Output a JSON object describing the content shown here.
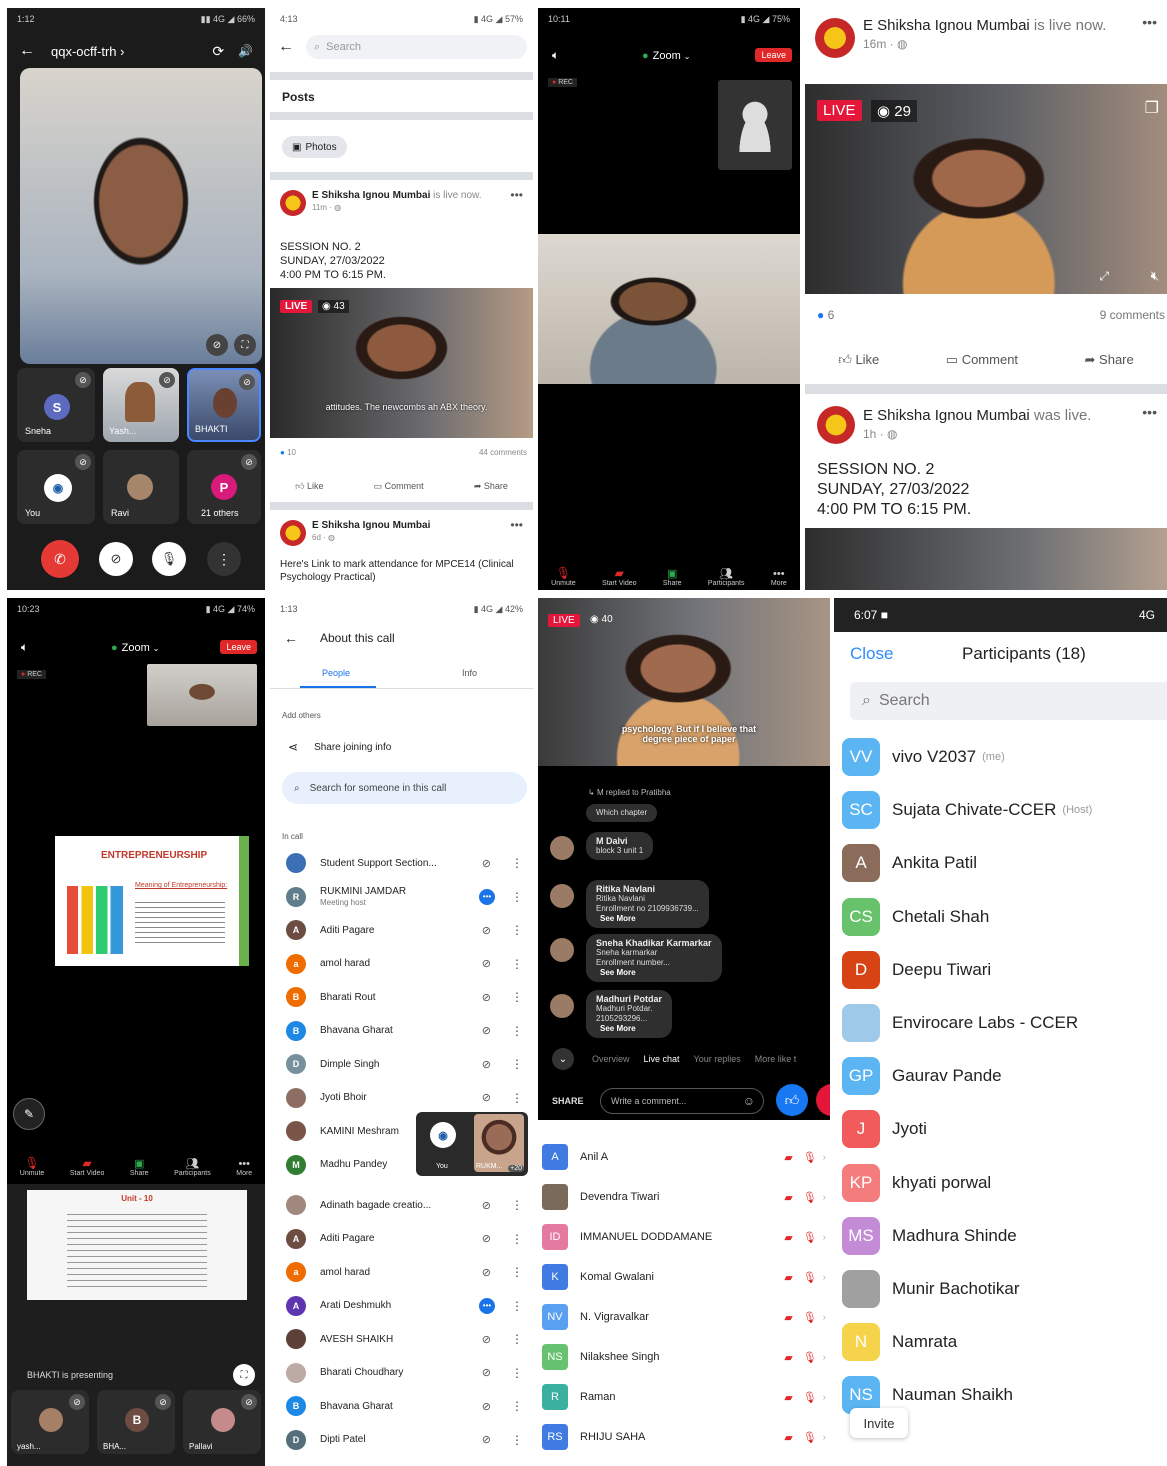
{
  "p1": {
    "status_time": "1:12",
    "meeting_code": "qqx-ocff-trh ›",
    "tiles": [
      {
        "name": "Sneha",
        "initial": "S"
      },
      {
        "name": "Yash...",
        "initial": ""
      },
      {
        "name": "BHAKTI",
        "initial": ""
      },
      {
        "name": "You",
        "initial": ""
      },
      {
        "name": "Ravi",
        "initial": ""
      },
      {
        "name": "21 others",
        "initial": "P"
      }
    ]
  },
  "p2": {
    "status_time": "4:13",
    "search_placeholder": "Search",
    "posts_label": "Posts",
    "photos_chip": "Photos",
    "post1": {
      "page": "E Shiksha Ignou Mumbai",
      "suffix": " is live now.",
      "time": "11m · ",
      "line1": "SESSION NO. 2",
      "line2": "SUNDAY, 27/03/2022",
      "line3": "4:00 PM TO 6:15 PM.",
      "live": "LIVE",
      "viewers": "43",
      "caption": "attitudes. The newcombs ah ABX theory.",
      "likes": "10",
      "comments": "44 comments",
      "like": "Like",
      "comment": "Comment",
      "share": "Share"
    },
    "post2": {
      "page": "E Shiksha Ignou Mumbai",
      "time": "6d · ",
      "text": "Here's Link to mark attendance for MPCE14 (Clinical Psychology Practical)"
    }
  },
  "p3": {
    "status_time": "10:11",
    "zoom_label": "Zoom",
    "leave": "Leave",
    "rec": "REC",
    "bar": [
      "Unmute",
      "Start Video",
      "Share",
      "Participants",
      "More"
    ]
  },
  "p4": {
    "page": "E Shiksha Ignou Mumbai",
    "suffix": " is live now.",
    "time": "16m · ",
    "live": "LIVE",
    "viewers": "29",
    "likes": "6",
    "comments": "9 comments",
    "like": "Like",
    "comment": "Comment",
    "share": "Share",
    "post2_suffix": " was live.",
    "post2_time": "1h · ",
    "line1": "SESSION NO. 2",
    "line2": "SUNDAY, 27/03/2022",
    "line3": "4:00 PM TO 6:15 PM."
  },
  "p5": {
    "status_time": "10:23",
    "zoom_label": "Zoom",
    "leave": "Leave",
    "rec": "REC",
    "slide_title": "ENTREPRENEURSHIP",
    "slide_sub": "Meaning of Entrepreneurship:",
    "bar": [
      "Unmute",
      "Start Video",
      "Share",
      "Participants",
      "More"
    ],
    "unit_title": "Unit - 10",
    "presenting": "BHAKTI is presenting",
    "bottom_tiles": [
      {
        "name": "yash...",
        "initial": ""
      },
      {
        "name": "BHA...",
        "initial": "B"
      },
      {
        "name": "Pallavi",
        "initial": ""
      }
    ]
  },
  "p6": {
    "status_time": "1:13",
    "title": "About this call",
    "tab_people": "People",
    "tab_info": "Info",
    "add_others": "Add others",
    "share_info": "Share joining info",
    "search_placeholder": "Search for someone in this call",
    "in_call": "In call",
    "people": [
      {
        "name": "Student Support Section...",
        "sub": "",
        "initial": "",
        "color": "#3b6fb6"
      },
      {
        "name": "RUKMINI JAMDAR",
        "sub": "Meeting host",
        "initial": "R",
        "color": "#607d8b"
      },
      {
        "name": "Aditi Pagare",
        "sub": "",
        "initial": "A",
        "color": "#6d4c41"
      },
      {
        "name": "amol harad",
        "sub": "",
        "initial": "a",
        "color": "#ef6c00"
      },
      {
        "name": "Bharati Rout",
        "sub": "",
        "initial": "B",
        "color": "#ef6c00"
      },
      {
        "name": "Bhavana Gharat",
        "sub": "",
        "initial": "B",
        "color": "#1e88e5"
      },
      {
        "name": "Dimple Singh",
        "sub": "",
        "initial": "D",
        "color": "#78909c"
      },
      {
        "name": "Jyoti Bhoir",
        "sub": "",
        "initial": "",
        "color": "#8d6e63"
      },
      {
        "name": "KAMINI Meshram",
        "sub": "",
        "initial": "",
        "color": "#795548"
      },
      {
        "name": "Madhu Pandey",
        "sub": "",
        "initial": "M",
        "color": "#2e7d32"
      },
      {
        "name": "Adinath bagade creatio...",
        "sub": "",
        "initial": "",
        "color": "#a1887f"
      },
      {
        "name": "Aditi Pagare",
        "sub": "",
        "initial": "A",
        "color": "#6d4c41"
      },
      {
        "name": "amol harad",
        "sub": "",
        "initial": "a",
        "color": "#ef6c00"
      },
      {
        "name": "Arati Deshmukh",
        "sub": "",
        "initial": "A",
        "color": "#5e35b1"
      },
      {
        "name": "AVESH SHAIKH",
        "sub": "",
        "initial": "",
        "color": "#5d4037"
      },
      {
        "name": "Bharati Choudhary",
        "sub": "",
        "initial": "",
        "color": "#bcaaa4"
      },
      {
        "name": "Bhavana Gharat",
        "sub": "",
        "initial": "B",
        "color": "#1e88e5"
      },
      {
        "name": "Dipti Patel",
        "sub": "",
        "initial": "D",
        "color": "#546e7a"
      }
    ],
    "pip_you": "You",
    "pip_other": "RUKM...",
    "pip_count": "+20"
  },
  "p7": {
    "live": "LIVE",
    "viewers": "40",
    "caption": "psychology. But if I believe that degree piece of paper",
    "reply_to": "M replied to Pratibha",
    "chats": [
      {
        "name": "",
        "text": "Which chapter",
        "more": ""
      },
      {
        "name": "M Dalvi",
        "text": "block 3 unit 1",
        "more": ""
      },
      {
        "name": "Ritika Navlani",
        "text": "Ritika Navlani\nEnrollment no 2109936739...",
        "more": "See More"
      },
      {
        "name": "Sneha Khadikar Karmarkar",
        "text": "Sneha karmarkar\nEnrollment number...",
        "more": "See More"
      },
      {
        "name": "Madhuri Potdar",
        "text": "Madhuri Potdar.\n2105293296...",
        "more": "See More"
      }
    ],
    "tabs": [
      "Overview",
      "Live chat",
      "Your replies",
      "More like t"
    ],
    "share": "SHARE",
    "comment_placeholder": "Write a comment...",
    "rows": [
      {
        "name": "Anil A",
        "initial": "A",
        "color": "#3f7be0"
      },
      {
        "name": "Devendra Tiwari",
        "initial": "",
        "color": "#7a6a5a"
      },
      {
        "name": "IMMANUEL DODDAMANE",
        "initial": "ID",
        "color": "#e57aa0"
      },
      {
        "name": "Komal Gwalani",
        "initial": "K",
        "color": "#3f7be0"
      },
      {
        "name": "N. Vigravalkar",
        "initial": "NV",
        "color": "#5aa0f0"
      },
      {
        "name": "Nilakshee Singh",
        "initial": "NS",
        "color": "#67c270"
      },
      {
        "name": "Raman",
        "initial": "R",
        "color": "#3bb0a0"
      },
      {
        "name": "RHIJU SAHA",
        "initial": "RS",
        "color": "#3f7be0"
      }
    ]
  },
  "p8": {
    "status_time": "6:07",
    "status_right": "4G",
    "close": "Close",
    "title": "Participants (18)",
    "search_placeholder": "Search",
    "invite": "Invite",
    "people": [
      {
        "name": "vivo V2037",
        "tag": "(me)",
        "initial": "VV",
        "color": "#5bb5f2"
      },
      {
        "name": "Sujata Chivate-CCER",
        "tag": "(Host)",
        "initial": "SC",
        "color": "#5bb5f2"
      },
      {
        "name": "Ankita Patil",
        "tag": "",
        "initial": "A",
        "color": "#8b6b5a"
      },
      {
        "name": "Chetali Shah",
        "tag": "",
        "initial": "CS",
        "color": "#67c26b"
      },
      {
        "name": "Deepu Tiwari",
        "tag": "",
        "initial": "D",
        "color": "#d84315"
      },
      {
        "name": "Envirocare Labs - CCER",
        "tag": "",
        "initial": "",
        "color": "#9fc9e8"
      },
      {
        "name": "Gaurav Pande",
        "tag": "",
        "initial": "GP",
        "color": "#5bb5f2"
      },
      {
        "name": "Jyoti",
        "tag": "",
        "initial": "J",
        "color": "#f15b5b"
      },
      {
        "name": "khyati porwal",
        "tag": "",
        "initial": "KP",
        "color": "#f47c7c"
      },
      {
        "name": "Madhura Shinde",
        "tag": "",
        "initial": "MS",
        "color": "#c48bd6"
      },
      {
        "name": "Munir Bachotikar",
        "tag": "",
        "initial": "",
        "color": "#a0a0a0"
      },
      {
        "name": "Namrata",
        "tag": "",
        "initial": "N",
        "color": "#f5d34a"
      },
      {
        "name": "Nauman Shaikh",
        "tag": "",
        "initial": "NS",
        "color": "#5bb5f2"
      }
    ]
  },
  "colors": {
    "zoom_green": "#2da94f",
    "leave_red": "#e02828",
    "fb_live": "#e4163a",
    "fb_blue": "#1877f2",
    "zoom_blue": "#2d8cff"
  }
}
